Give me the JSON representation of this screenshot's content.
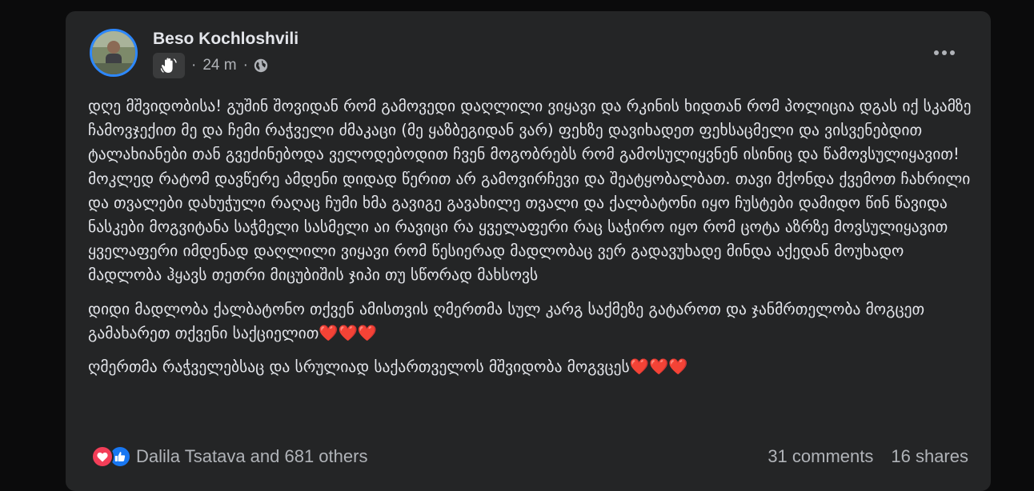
{
  "post": {
    "author": "Beso Kochloshvili",
    "time": "24 m",
    "separator1": "·",
    "separator2": "·",
    "badge_icon": "wave-hand-icon",
    "audience_icon": "globe-icon",
    "menu_icon": "more-dots-icon",
    "paragraphs": [
      "დღე მშვიდობისა! გუშინ შოვიდან რომ გამოვედი დაღლილი ვიყავი და რკინის ხიდთან რომ პოლიცია დგას იქ სკამზე ჩამოვჯექით მე და ჩემი რაჭველი ძმაკაცი (მე ყაზბეგიდან ვარ) ფეხზე დავიხადეთ ფეხსაცმელი და ვისვენებდით ტალახიანები თან გვეძინებოდა ველოდებოდით ჩვენ მოგობრებს რომ გამოსულიყვნენ ისინიც და წამოვსულიყავით! მოკლედ რატომ დავწერე ამდენი დიდად წერით არ გამოვირჩევი და შეატყობალბათ. თავი მქონდა ქვემოთ ჩახრილი და თვალები დახუჭული რაღაც ჩუმი ხმა გავიგე გავახილე თვალი და ქალბატონი იყო ჩუსტები დამიდო წინ წავიდა ნასკები მოგვიტანა საჭმელი სასმელი აი რავიცი რა ყველაფერი რაც საჭირო იყო რომ ცოტა აზრზე მოვსულიყავით ყველაფერი იმდენად დაღლილი ვიყავი რომ წესიერად მადლობაც ვერ გადავუხადე მინდა აქედან მოუხადო მადლობა ჰყავს თეთრი მიცუბიშის ჯიპი თუ სწორად მახსოვს",
      "დიდი მადლობა ქალბატონო თქვენ ამისთვის ღმერთმა სულ კარგ საქმეზე გატაროთ და ჯანმრთელობა მოგცეთ გამახარეთ თქვენი საქციელით",
      "ღმერთმა რაჭველებსაც და სრულიად საქართველოს მშვიდობა მოგვცეს"
    ],
    "hearts": "❤️❤️❤️",
    "reactions_text": "Dalila Tsatava and 681 others",
    "reaction_icons": [
      "love-reaction-icon",
      "like-reaction-icon"
    ],
    "comments": "31 comments",
    "shares": "16 shares"
  },
  "colors": {
    "card_bg": "#242526",
    "page_bg": "#0b0b0c",
    "text_primary": "#e4e6eb",
    "text_secondary": "#b0b3b8",
    "accent_blue": "#2d88ff",
    "love_red": "#f33e58",
    "like_blue": "#1877f2"
  }
}
